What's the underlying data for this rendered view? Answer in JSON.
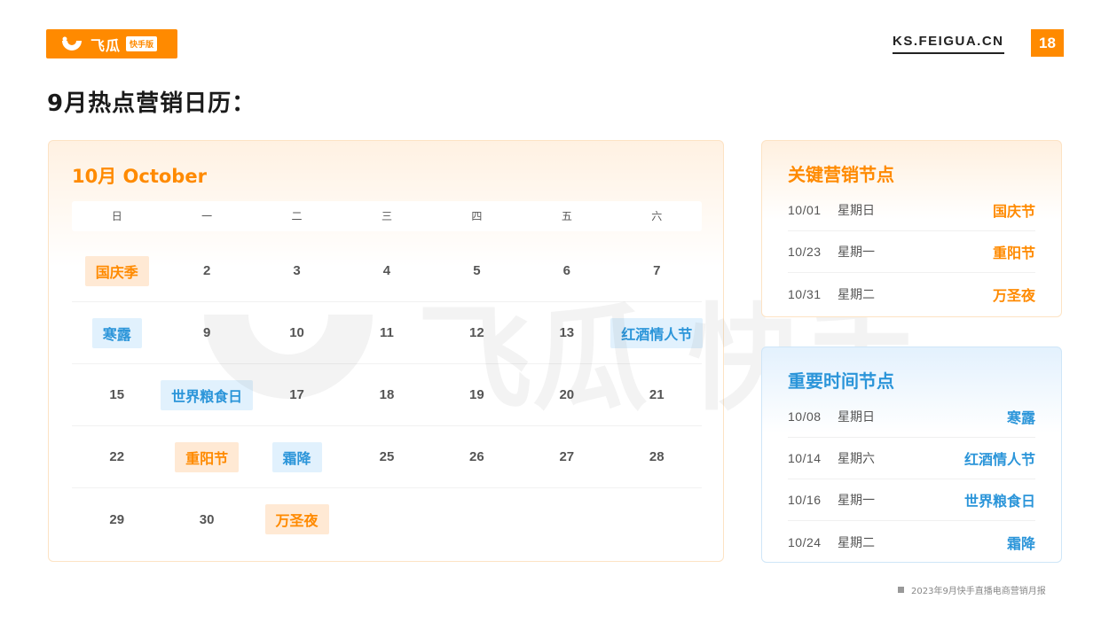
{
  "header": {
    "logo_text": "飞瓜",
    "logo_tag": "快手版",
    "site": "KS.FEIGUA.CN",
    "page_number": "18"
  },
  "title": "9月热点营销日历：",
  "calendar": {
    "title": "10月 October",
    "weekdays": [
      "日",
      "一",
      "二",
      "三",
      "四",
      "五",
      "六"
    ],
    "rows": [
      [
        {
          "tag": "国庆季",
          "color": "orange"
        },
        {
          "num": "2"
        },
        {
          "num": "3"
        },
        {
          "num": "4"
        },
        {
          "num": "5"
        },
        {
          "num": "6"
        },
        {
          "num": "7"
        }
      ],
      [
        {
          "tag": "寒露",
          "color": "blue"
        },
        {
          "num": "9"
        },
        {
          "num": "10"
        },
        {
          "num": "11"
        },
        {
          "num": "12"
        },
        {
          "num": "13"
        },
        {
          "tag": "红酒情人节",
          "color": "blue"
        }
      ],
      [
        {
          "num": "15"
        },
        {
          "tag": "世界粮食日",
          "color": "blue"
        },
        {
          "num": "17"
        },
        {
          "num": "18"
        },
        {
          "num": "19"
        },
        {
          "num": "20"
        },
        {
          "num": "21"
        }
      ],
      [
        {
          "num": "22"
        },
        {
          "tag": "重阳节",
          "color": "orange"
        },
        {
          "tag": "霜降",
          "color": "blue"
        },
        {
          "num": "25"
        },
        {
          "num": "26"
        },
        {
          "num": "27"
        },
        {
          "num": "28"
        }
      ],
      [
        {
          "num": "29"
        },
        {
          "num": "30"
        },
        {
          "tag": "万圣夜",
          "color": "orange"
        },
        {},
        {},
        {},
        {}
      ]
    ]
  },
  "key_nodes": {
    "title": "关键营销节点",
    "items": [
      {
        "date": "10/01",
        "weekday": "星期日",
        "event": "国庆节"
      },
      {
        "date": "10/23",
        "weekday": "星期一",
        "event": "重阳节"
      },
      {
        "date": "10/31",
        "weekday": "星期二",
        "event": "万圣夜"
      }
    ]
  },
  "important_nodes": {
    "title": "重要时间节点",
    "items": [
      {
        "date": "10/08",
        "weekday": "星期日",
        "event": "寒露"
      },
      {
        "date": "10/14",
        "weekday": "星期六",
        "event": "红酒情人节"
      },
      {
        "date": "10/16",
        "weekday": "星期一",
        "event": "世界粮食日"
      },
      {
        "date": "10/24",
        "weekday": "星期二",
        "event": "霜降"
      }
    ]
  },
  "watermark": {
    "text": "飞瓜 快手版"
  },
  "footer": "2023年9月快手直播电商营销月报",
  "colors": {
    "accent_orange": "#ff8a00",
    "accent_blue": "#2b95d9"
  }
}
